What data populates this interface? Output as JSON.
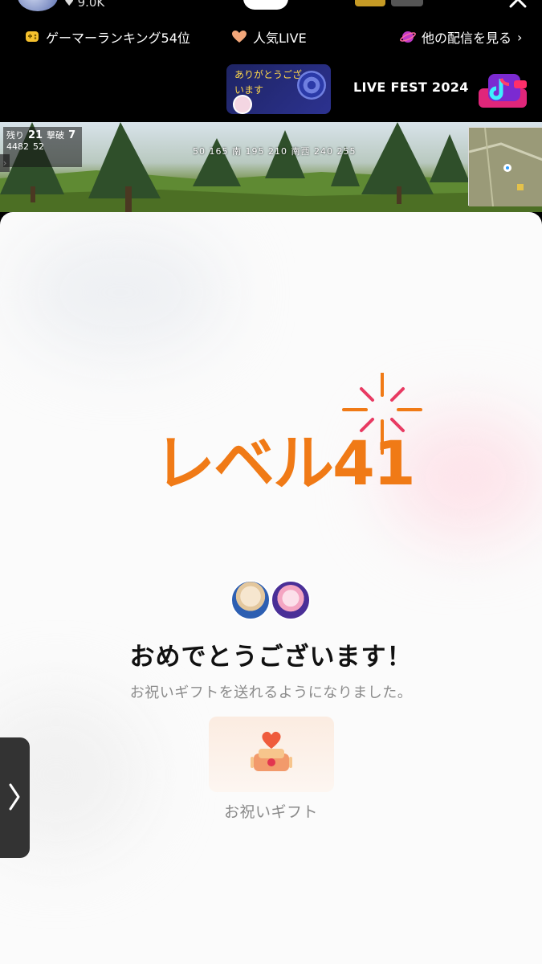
{
  "header": {
    "like_count": "9.0K",
    "ranking_label": "ゲーマーランキング54位",
    "popular_label": "人気LIVE",
    "other_streams_label": "他の配信を見る"
  },
  "banner": {
    "thanks_text": "ありがとうございます",
    "event_title": "LIVE FEST 2024"
  },
  "game_hud": {
    "top_left_label": "残り",
    "alive_count": "21",
    "kill_label": "撃破",
    "kill_count": "7",
    "score": "4482",
    "ping": "52",
    "compass": "50  165  南  195  210  南西  240  255"
  },
  "level_up": {
    "title": "レベル41",
    "congrats": "おめでとうございます！",
    "description": "お祝いギフトを送れるようになりました。",
    "gift_label": "お祝いギフト"
  },
  "colors": {
    "accent_orange": "#f07a16",
    "sparkle_pink": "#e83a62",
    "sheet_bg": "#fbfbfb"
  }
}
